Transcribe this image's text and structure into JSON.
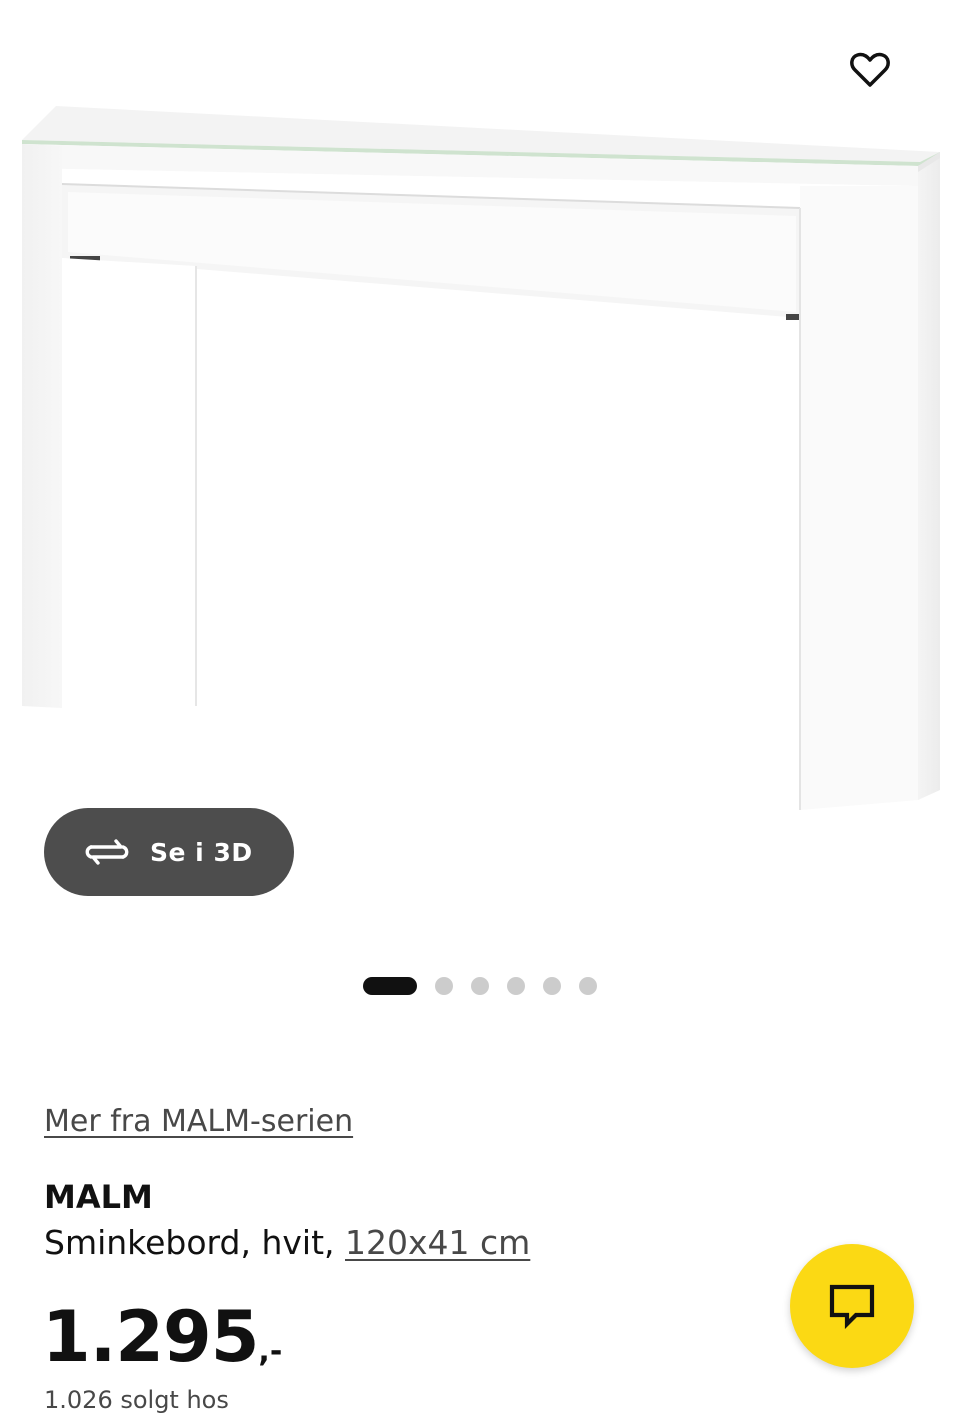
{
  "gallery": {
    "product_image_alt": "MALM Sminkebord, hvit",
    "view_3d_label": "Se i 3D",
    "slide_count": 6,
    "active_slide": 1,
    "favorite_icon": "heart-outline-icon",
    "view_3d_icon": "rotate-3d-icon"
  },
  "product": {
    "series_link": "Mer fra MALM-serien",
    "name": "MALM",
    "description_prefix": "Sminkebord, hvit,",
    "size_link": "120x41 cm",
    "price_amount": "1.295",
    "price_suffix": ",-",
    "sub_text": "1.026 solgt hos"
  },
  "chat": {
    "icon": "chat-bubble-icon",
    "color": "#fbd914"
  },
  "colors": {
    "accent_yellow": "#fbd914",
    "button_dark": "#4d4d4d",
    "text_primary": "#111111",
    "text_secondary": "#484848",
    "dot_inactive": "#cccccc"
  }
}
